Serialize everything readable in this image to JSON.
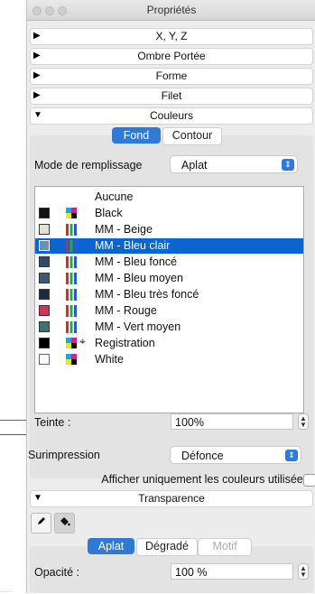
{
  "window": {
    "title": "Propriétés"
  },
  "sections": {
    "xyz": {
      "label": "X, Y, Z",
      "arrow": "▶"
    },
    "ombre": {
      "label": "Ombre Portée",
      "arrow": "▶"
    },
    "forme": {
      "label": "Forme",
      "arrow": "▶"
    },
    "filet": {
      "label": "Filet",
      "arrow": "▶"
    },
    "couleurs": {
      "label": "Couleurs",
      "arrow": "▼"
    },
    "transparence": {
      "label": "Transparence",
      "arrow": "▼"
    }
  },
  "couleurs": {
    "tabs": {
      "fond": "Fond",
      "contour": "Contour"
    },
    "fill_mode_label": "Mode de remplissage",
    "fill_mode_value": "Aplat",
    "swatches": [
      {
        "name": "Aucune",
        "color": "",
        "icon": "none"
      },
      {
        "name": "Black",
        "color": "#111111",
        "icon": "cmyk"
      },
      {
        "name": "MM - Beige",
        "color": "#e4e0d4",
        "icon": "rgb"
      },
      {
        "name": "MM - Bleu clair",
        "color": "#6c8fb6",
        "icon": "rgb",
        "selected": true
      },
      {
        "name": "MM - Bleu foncé",
        "color": "#2e4a66",
        "icon": "rgb"
      },
      {
        "name": "MM - Bleu moyen",
        "color": "#3b5a7a",
        "icon": "rgb"
      },
      {
        "name": "MM - Bleu très foncé",
        "color": "#1d2a44",
        "icon": "rgb"
      },
      {
        "name": "MM - Rouge",
        "color": "#cf3358",
        "icon": "rgb"
      },
      {
        "name": "MM - Vert moyen",
        "color": "#3e7370",
        "icon": "rgb"
      },
      {
        "name": "Registration",
        "color": "#000000",
        "icon": "registration"
      },
      {
        "name": "White",
        "color": "#ffffff",
        "icon": "cmyk"
      }
    ],
    "teinte_label": "Teinte :",
    "teinte_value": "100%",
    "surimpression_label": "Surimpression",
    "surimpression_value": "Défonce",
    "only_used_label": "Afficher uniquement les couleurs utilisées"
  },
  "transparence": {
    "tools": [
      "pen-icon",
      "fill-bucket-icon"
    ],
    "tabs": {
      "aplat": "Aplat",
      "degrade": "Dégradé",
      "motif": "Motif"
    },
    "opacite_label": "Opacité :",
    "opacite_value": "100 %"
  },
  "background_fragment": "........."
}
